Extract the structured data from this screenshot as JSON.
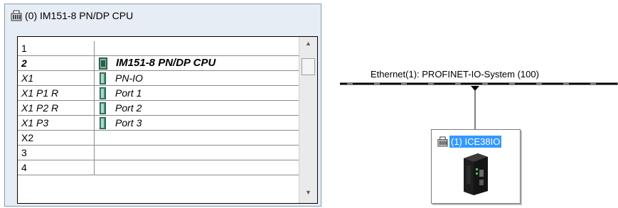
{
  "station": {
    "title": "(0) IM151-8 PN/DP CPU",
    "rows": [
      {
        "slot": "1",
        "module": "",
        "style": "normal",
        "icon": ""
      },
      {
        "slot": "2",
        "module": "IM151-8 PN/DP CPU",
        "style": "bold-italic",
        "icon": "cpu-module-icon"
      },
      {
        "slot": "X1",
        "module": "PN-IO",
        "style": "italic",
        "icon": "interface-module-icon"
      },
      {
        "slot": "X1 P1 R",
        "module": "Port 1",
        "style": "italic",
        "icon": "port-module-icon"
      },
      {
        "slot": "X1 P2 R",
        "module": "Port 2",
        "style": "italic",
        "icon": "port-module-icon"
      },
      {
        "slot": "X1 P3",
        "module": "Port 3",
        "style": "italic",
        "icon": "port-module-icon"
      },
      {
        "slot": "X2",
        "module": "",
        "style": "normal",
        "icon": ""
      },
      {
        "slot": "3",
        "module": "",
        "style": "normal",
        "icon": ""
      },
      {
        "slot": "4",
        "module": "",
        "style": "normal",
        "icon": ""
      }
    ]
  },
  "network": {
    "label": "Ethernet(1): PROFINET-IO-System (100)"
  },
  "device": {
    "name": "(1) ICE38IO",
    "selected_color": "#3399ff"
  },
  "colors": {
    "panel_bg": "#e6edf5",
    "bus_line": "#000000"
  }
}
